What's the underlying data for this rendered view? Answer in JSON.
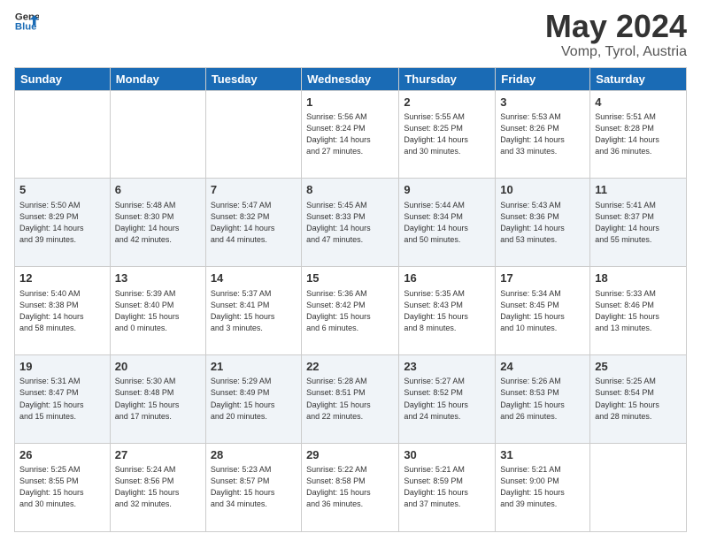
{
  "logo": {
    "line1": "General",
    "line2": "Blue"
  },
  "title": "May 2024",
  "subtitle": "Vomp, Tyrol, Austria",
  "days_of_week": [
    "Sunday",
    "Monday",
    "Tuesday",
    "Wednesday",
    "Thursday",
    "Friday",
    "Saturday"
  ],
  "weeks": [
    [
      {
        "num": "",
        "info": ""
      },
      {
        "num": "",
        "info": ""
      },
      {
        "num": "",
        "info": ""
      },
      {
        "num": "1",
        "info": "Sunrise: 5:56 AM\nSunset: 8:24 PM\nDaylight: 14 hours\nand 27 minutes."
      },
      {
        "num": "2",
        "info": "Sunrise: 5:55 AM\nSunset: 8:25 PM\nDaylight: 14 hours\nand 30 minutes."
      },
      {
        "num": "3",
        "info": "Sunrise: 5:53 AM\nSunset: 8:26 PM\nDaylight: 14 hours\nand 33 minutes."
      },
      {
        "num": "4",
        "info": "Sunrise: 5:51 AM\nSunset: 8:28 PM\nDaylight: 14 hours\nand 36 minutes."
      }
    ],
    [
      {
        "num": "5",
        "info": "Sunrise: 5:50 AM\nSunset: 8:29 PM\nDaylight: 14 hours\nand 39 minutes."
      },
      {
        "num": "6",
        "info": "Sunrise: 5:48 AM\nSunset: 8:30 PM\nDaylight: 14 hours\nand 42 minutes."
      },
      {
        "num": "7",
        "info": "Sunrise: 5:47 AM\nSunset: 8:32 PM\nDaylight: 14 hours\nand 44 minutes."
      },
      {
        "num": "8",
        "info": "Sunrise: 5:45 AM\nSunset: 8:33 PM\nDaylight: 14 hours\nand 47 minutes."
      },
      {
        "num": "9",
        "info": "Sunrise: 5:44 AM\nSunset: 8:34 PM\nDaylight: 14 hours\nand 50 minutes."
      },
      {
        "num": "10",
        "info": "Sunrise: 5:43 AM\nSunset: 8:36 PM\nDaylight: 14 hours\nand 53 minutes."
      },
      {
        "num": "11",
        "info": "Sunrise: 5:41 AM\nSunset: 8:37 PM\nDaylight: 14 hours\nand 55 minutes."
      }
    ],
    [
      {
        "num": "12",
        "info": "Sunrise: 5:40 AM\nSunset: 8:38 PM\nDaylight: 14 hours\nand 58 minutes."
      },
      {
        "num": "13",
        "info": "Sunrise: 5:39 AM\nSunset: 8:40 PM\nDaylight: 15 hours\nand 0 minutes."
      },
      {
        "num": "14",
        "info": "Sunrise: 5:37 AM\nSunset: 8:41 PM\nDaylight: 15 hours\nand 3 minutes."
      },
      {
        "num": "15",
        "info": "Sunrise: 5:36 AM\nSunset: 8:42 PM\nDaylight: 15 hours\nand 6 minutes."
      },
      {
        "num": "16",
        "info": "Sunrise: 5:35 AM\nSunset: 8:43 PM\nDaylight: 15 hours\nand 8 minutes."
      },
      {
        "num": "17",
        "info": "Sunrise: 5:34 AM\nSunset: 8:45 PM\nDaylight: 15 hours\nand 10 minutes."
      },
      {
        "num": "18",
        "info": "Sunrise: 5:33 AM\nSunset: 8:46 PM\nDaylight: 15 hours\nand 13 minutes."
      }
    ],
    [
      {
        "num": "19",
        "info": "Sunrise: 5:31 AM\nSunset: 8:47 PM\nDaylight: 15 hours\nand 15 minutes."
      },
      {
        "num": "20",
        "info": "Sunrise: 5:30 AM\nSunset: 8:48 PM\nDaylight: 15 hours\nand 17 minutes."
      },
      {
        "num": "21",
        "info": "Sunrise: 5:29 AM\nSunset: 8:49 PM\nDaylight: 15 hours\nand 20 minutes."
      },
      {
        "num": "22",
        "info": "Sunrise: 5:28 AM\nSunset: 8:51 PM\nDaylight: 15 hours\nand 22 minutes."
      },
      {
        "num": "23",
        "info": "Sunrise: 5:27 AM\nSunset: 8:52 PM\nDaylight: 15 hours\nand 24 minutes."
      },
      {
        "num": "24",
        "info": "Sunrise: 5:26 AM\nSunset: 8:53 PM\nDaylight: 15 hours\nand 26 minutes."
      },
      {
        "num": "25",
        "info": "Sunrise: 5:25 AM\nSunset: 8:54 PM\nDaylight: 15 hours\nand 28 minutes."
      }
    ],
    [
      {
        "num": "26",
        "info": "Sunrise: 5:25 AM\nSunset: 8:55 PM\nDaylight: 15 hours\nand 30 minutes."
      },
      {
        "num": "27",
        "info": "Sunrise: 5:24 AM\nSunset: 8:56 PM\nDaylight: 15 hours\nand 32 minutes."
      },
      {
        "num": "28",
        "info": "Sunrise: 5:23 AM\nSunset: 8:57 PM\nDaylight: 15 hours\nand 34 minutes."
      },
      {
        "num": "29",
        "info": "Sunrise: 5:22 AM\nSunset: 8:58 PM\nDaylight: 15 hours\nand 36 minutes."
      },
      {
        "num": "30",
        "info": "Sunrise: 5:21 AM\nSunset: 8:59 PM\nDaylight: 15 hours\nand 37 minutes."
      },
      {
        "num": "31",
        "info": "Sunrise: 5:21 AM\nSunset: 9:00 PM\nDaylight: 15 hours\nand 39 minutes."
      },
      {
        "num": "",
        "info": ""
      }
    ]
  ]
}
